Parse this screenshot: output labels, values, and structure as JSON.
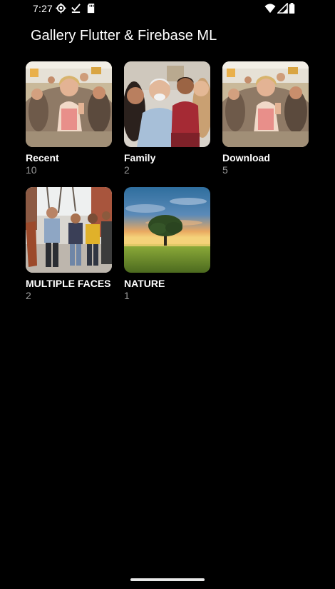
{
  "status_bar": {
    "time": "7:27",
    "icons_left": [
      "settings-gear-icon",
      "download-done-icon",
      "sd-card-icon"
    ],
    "icons_right": [
      "wifi-icon",
      "cell-signal-icon",
      "battery-icon"
    ]
  },
  "app": {
    "title": "Gallery Flutter & Firebase ML"
  },
  "albums": [
    {
      "name": "Recent",
      "count": "10",
      "thumbnail": "crowd-festival-photo"
    },
    {
      "name": "Family",
      "count": "2",
      "thumbnail": "family-portrait-photo"
    },
    {
      "name": "Download",
      "count": "5",
      "thumbnail": "crowd-festival-photo"
    },
    {
      "name": "MULTIPLE FACES",
      "count": "2",
      "thumbnail": "friends-walking-street-photo"
    },
    {
      "name": "NATURE",
      "count": "1",
      "thumbnail": "tree-sunset-field-photo"
    }
  ],
  "colors": {
    "background": "#000000",
    "text_primary": "#ffffff",
    "text_secondary": "#9b9b9b",
    "home_indicator": "#e8e8e8"
  }
}
